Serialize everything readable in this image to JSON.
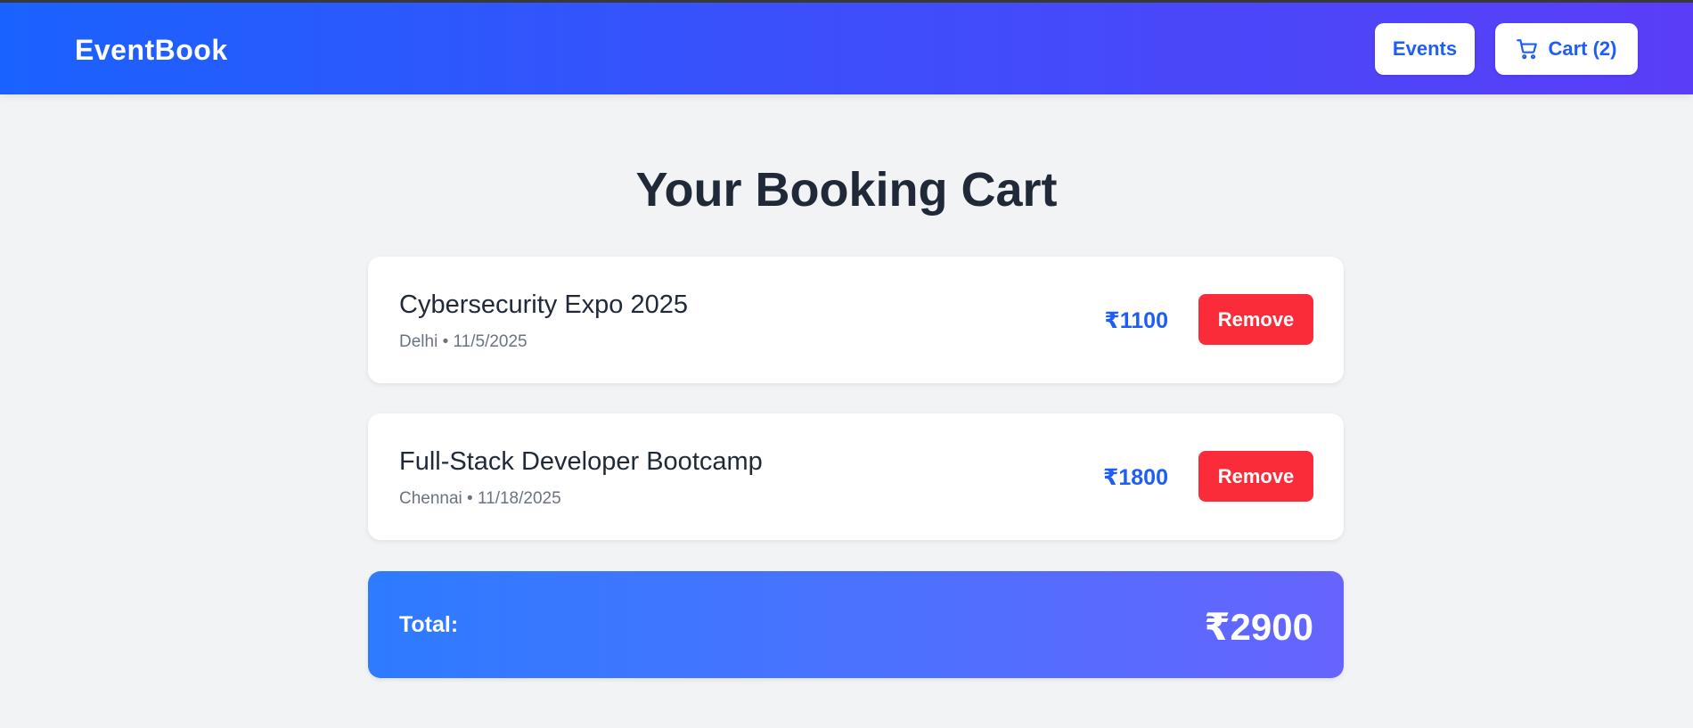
{
  "header": {
    "brand": "EventBook",
    "events_label": "Events",
    "cart_label": "Cart (2)"
  },
  "page": {
    "title": "Your Booking Cart"
  },
  "cart": {
    "items": [
      {
        "name": "Cybersecurity Expo 2025",
        "city": "Delhi",
        "date": "11/5/2025",
        "meta": "Delhi • 11/5/2025",
        "price": "₹1100",
        "remove_label": "Remove"
      },
      {
        "name": "Full-Stack Developer Bootcamp",
        "city": "Chennai",
        "date": "11/18/2025",
        "meta": "Chennai • 11/18/2025",
        "price": "₹1800",
        "remove_label": "Remove"
      }
    ],
    "total_label": "Total:",
    "total_value": "₹2900"
  },
  "colors": {
    "accent": "#1e5ef5",
    "danger": "#fb2c3a",
    "header_gradient_start": "#1a62ff",
    "header_gradient_end": "#5a3ef7",
    "background": "#f2f3f5"
  },
  "icons": {
    "cart": "shopping-cart-icon"
  }
}
